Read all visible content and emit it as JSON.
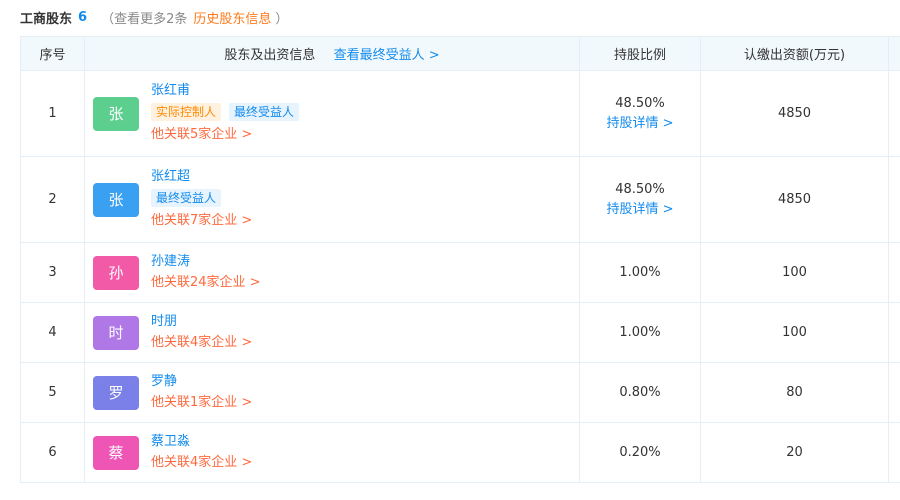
{
  "header": {
    "title": "工商股东",
    "count": "6",
    "more_text": "（查看更多2条",
    "history_link": "历史股东信息",
    "close_paren": "）"
  },
  "table": {
    "columns": {
      "index": "序号",
      "shareholder": "股东及出资信息",
      "beneficiary_link": "查看最终受益人 >",
      "ratio": "持股比例",
      "capital": "认缴出资额(万元)"
    },
    "rows": [
      {
        "index": "1",
        "avatar": "张",
        "avatar_color": "#5ccf8f",
        "name": "张红甫",
        "tags": [
          {
            "label": "实际控制人",
            "style": "orange"
          },
          {
            "label": "最终受益人",
            "style": "blue"
          }
        ],
        "related": "他关联5家企业 >",
        "ratio": "48.50%",
        "ratio_detail": "持股详情 >",
        "capital": "4850"
      },
      {
        "index": "2",
        "avatar": "张",
        "avatar_color": "#3aa0f2",
        "name": "张红超",
        "tags": [
          {
            "label": "最终受益人",
            "style": "blue"
          }
        ],
        "related": "他关联7家企业 >",
        "ratio": "48.50%",
        "ratio_detail": "持股详情 >",
        "capital": "4850"
      },
      {
        "index": "3",
        "avatar": "孙",
        "avatar_color": "#f25aa8",
        "name": "孙建涛",
        "tags": [],
        "related": "他关联24家企业 >",
        "ratio": "1.00%",
        "ratio_detail": "",
        "capital": "100"
      },
      {
        "index": "4",
        "avatar": "时",
        "avatar_color": "#b078e6",
        "name": "时朋",
        "tags": [],
        "related": "他关联4家企业 >",
        "ratio": "1.00%",
        "ratio_detail": "",
        "capital": "100"
      },
      {
        "index": "5",
        "avatar": "罗",
        "avatar_color": "#7a80e8",
        "name": "罗静",
        "tags": [],
        "related": "他关联1家企业 >",
        "ratio": "0.80%",
        "ratio_detail": "",
        "capital": "80"
      },
      {
        "index": "6",
        "avatar": "蔡",
        "avatar_color": "#ee55b4",
        "name": "蔡卫淼",
        "tags": [],
        "related": "他关联4家企业 >",
        "ratio": "0.20%",
        "ratio_detail": "",
        "capital": "20"
      }
    ]
  }
}
